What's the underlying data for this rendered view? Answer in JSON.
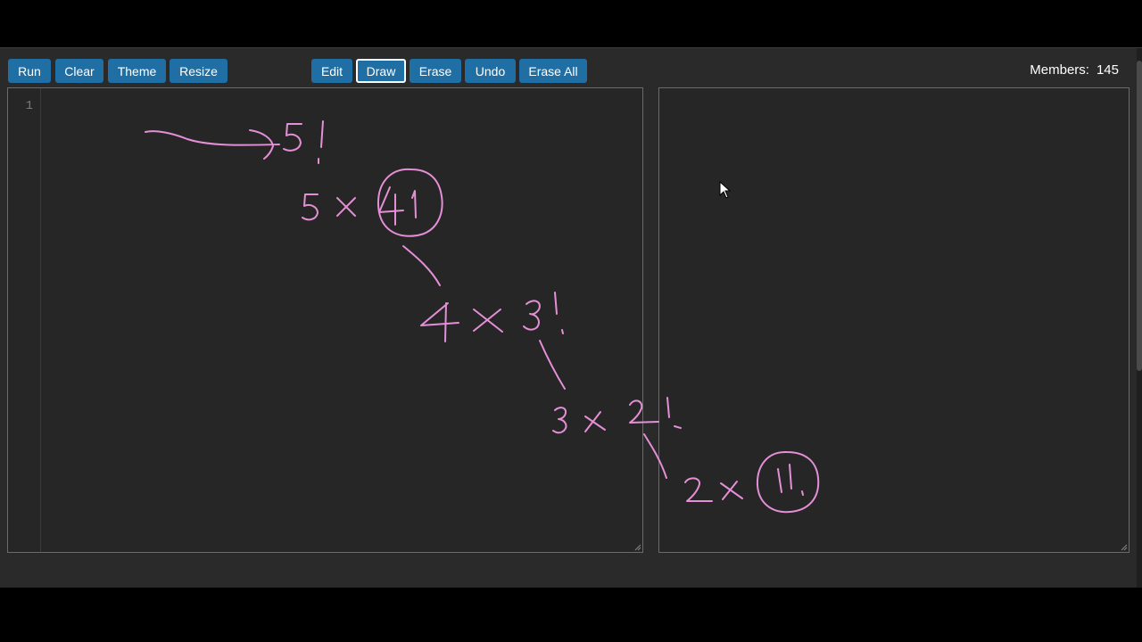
{
  "toolbar": {
    "run_label": "Run",
    "clear_label": "Clear",
    "theme_label": "Theme",
    "resize_label": "Resize",
    "edit_label": "Edit",
    "draw_label": "Draw",
    "erase_label": "Erase",
    "undo_label": "Undo",
    "erase_all_label": "Erase All",
    "active_tool": "Draw"
  },
  "members": {
    "label": "Members:",
    "count": "145"
  },
  "editor": {
    "line_numbers": [
      "1"
    ]
  },
  "colors": {
    "button": "#1f6fa5",
    "ink": "#e58fd7",
    "panel": "#262626",
    "background": "#2a2a2a"
  }
}
